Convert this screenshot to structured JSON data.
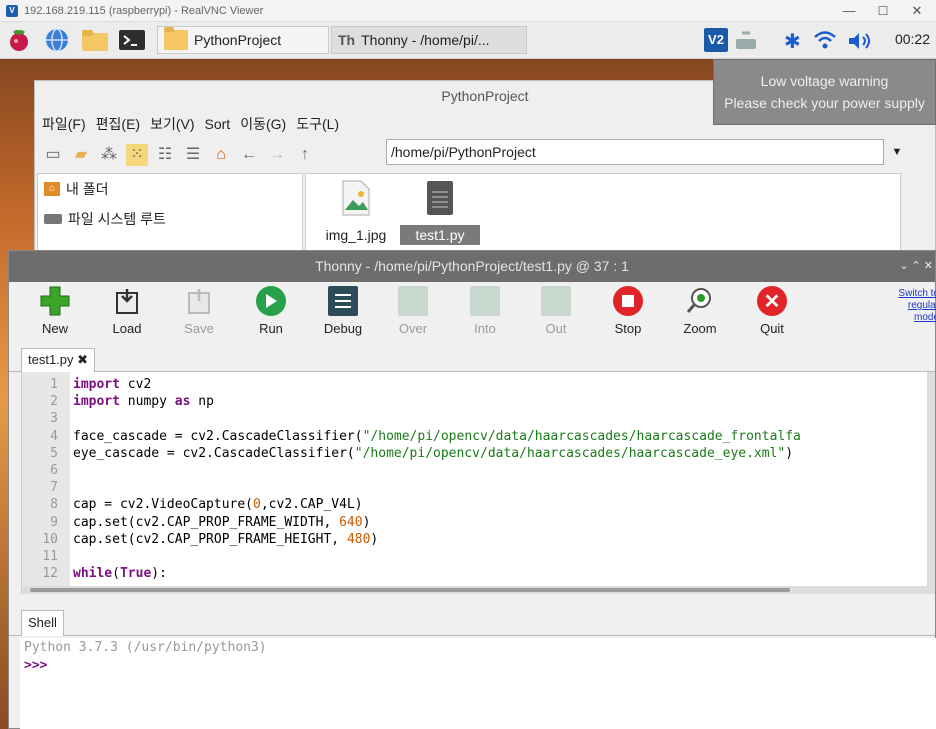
{
  "vnc": {
    "title": "192.168.219.115 (raspberrypi) - RealVNC Viewer",
    "minimize": "—",
    "maximize": "☐",
    "close": "✕"
  },
  "taskbar": {
    "tasks": [
      {
        "label": "PythonProject"
      },
      {
        "label": "Thonny  -  /home/pi/..."
      }
    ],
    "clock": "00:22",
    "vnc_badge": "V2"
  },
  "tooltip": {
    "line1": "Low voltage warning",
    "line2": "Please check your power supply"
  },
  "file_manager": {
    "title": "PythonProject",
    "menu": [
      "파일(F)",
      "편집(E)",
      "보기(V)",
      "Sort",
      "이동(G)",
      "도구(L)"
    ],
    "path": "/home/pi/PythonProject",
    "sidebar": [
      {
        "label": "내 폴더"
      },
      {
        "label": "파일 시스템 루트"
      }
    ],
    "files": [
      {
        "name": "img_1.jpg"
      },
      {
        "name": "test1.py",
        "selected": true
      }
    ]
  },
  "thonny": {
    "title": "Thonny  -  /home/pi/PythonProject/test1.py  @  37 : 1",
    "toolbar": [
      {
        "label": "New",
        "icon": "plus-icon",
        "color": "#3ba52a"
      },
      {
        "label": "Load",
        "icon": "load-icon",
        "color": "#333333"
      },
      {
        "label": "Save",
        "icon": "save-icon",
        "color": "#bbbbbb",
        "disabled": true
      },
      {
        "label": "Run",
        "icon": "run-icon",
        "color": "#27a14a"
      },
      {
        "label": "Debug",
        "icon": "debug-icon",
        "color": "#2c4a58"
      },
      {
        "label": "Over",
        "icon": "step-over-icon",
        "color": "#c9d8cf",
        "disabled": true
      },
      {
        "label": "Into",
        "icon": "step-into-icon",
        "color": "#c9d8cf",
        "disabled": true
      },
      {
        "label": "Out",
        "icon": "step-out-icon",
        "color": "#c9d8cf",
        "disabled": true
      },
      {
        "label": "Stop",
        "icon": "stop-icon",
        "color": "#e0242a"
      },
      {
        "label": "Zoom",
        "icon": "zoom-icon",
        "color": "#2a9a2a"
      },
      {
        "label": "Quit",
        "icon": "quit-icon",
        "color": "#e0242a"
      }
    ],
    "switch_mode": "Switch to regular mode",
    "tab": "test1.py ✖",
    "code_lines": [
      "import cv2",
      "import numpy as np",
      "",
      "face_cascade = cv2.CascadeClassifier(\"/home/pi/opencv/data/haarcascades/haarcascade_frontalfa",
      "eye_cascade = cv2.CascadeClassifier(\"/home/pi/opencv/data/haarcascades/haarcascade_eye.xml\")",
      "",
      "",
      "cap = cv2.VideoCapture(0,cv2.CAP_V4L)",
      "cap.set(cv2.CAP_PROP_FRAME_WIDTH, 640)",
      "cap.set(cv2.CAP_PROP_FRAME_HEIGHT, 480)",
      "",
      "while(True):"
    ],
    "shell_tab": "Shell",
    "shell_lines": [
      "Python 3.7.3 (/usr/bin/python3)",
      ">>>"
    ]
  }
}
